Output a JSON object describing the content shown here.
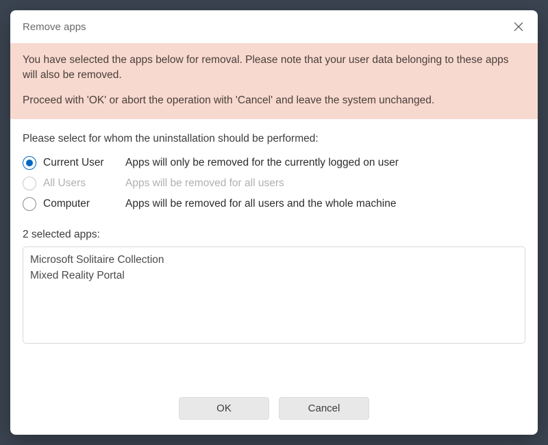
{
  "titlebar": {
    "title": "Remove apps"
  },
  "warning": {
    "p1": "You have selected the apps below for removal. Please note that your user data belonging to these apps will also be removed.",
    "p2": "Proceed with 'OK' or abort the operation with 'Cancel' and leave the system unchanged."
  },
  "selectPrompt": "Please select for whom the uninstallation should be performed:",
  "radios": {
    "currentUser": {
      "label": "Current User",
      "desc": "Apps will only be removed for the currently logged on user"
    },
    "allUsers": {
      "label": "All Users",
      "desc": "Apps will be removed for all users"
    },
    "computer": {
      "label": "Computer",
      "desc": "Apps will be removed for all users and the whole machine"
    }
  },
  "appsCount": "2 selected apps:",
  "apps": [
    "Microsoft Solitaire Collection",
    "Mixed Reality Portal"
  ],
  "buttons": {
    "ok": "OK",
    "cancel": "Cancel"
  }
}
